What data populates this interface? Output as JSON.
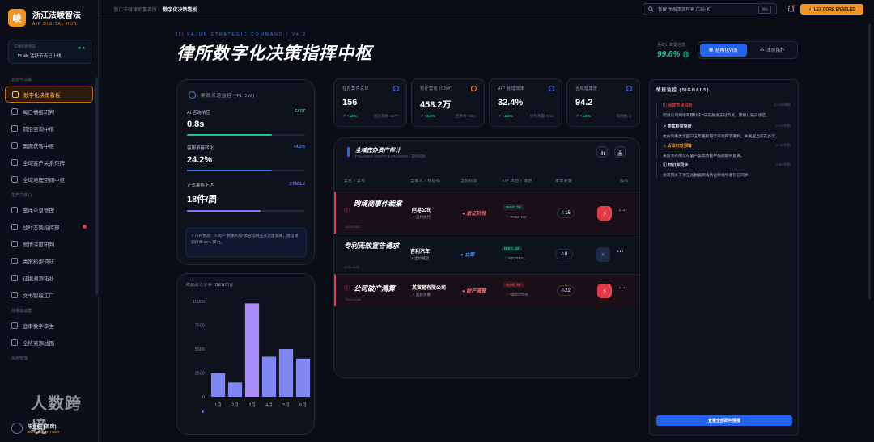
{
  "brand": {
    "badge": "崚",
    "name": "浙江法崚智法",
    "sub": "AIP DIGITAL HUB"
  },
  "sidebar": {
    "status_label": "实体同步状态",
    "status_value": "15.4K 活跃节点已上线",
    "sections": [
      {
        "title": "智能与决策",
        "items": [
          {
            "label": "数字化决策看板",
            "active": true
          },
          {
            "label": "每日情报研判"
          },
          {
            "label": "前沿咨询中枢"
          },
          {
            "label": "案源获客中枢"
          },
          {
            "label": "全域客户关系矩阵"
          },
          {
            "label": "全域地理空间中枢"
          }
        ]
      },
      {
        "title": "生产力核心",
        "items": [
          {
            "label": "案件全景管理"
          },
          {
            "label": "战时态势指挥部",
            "dot": true
          },
          {
            "label": "案情深度研判"
          },
          {
            "label": "类案检索调研"
          },
          {
            "label": "证据溯源拓扑"
          },
          {
            "label": "文书智绘工厂"
          }
        ]
      },
      {
        "title": "战争模拟器",
        "items": [
          {
            "label": "庭审数字孪生"
          },
          {
            "label": "全所资源战图"
          }
        ]
      },
      {
        "title": "风险管理",
        "items": []
      }
    ],
    "footer_name": "陈主任 (首席)",
    "footer_role": "SENIOR PARTNER"
  },
  "watermark": "人数跨境",
  "topbar": {
    "breadcrumb_root": "浙江法崚律师事务所 /",
    "breadcrumb_current": "数字化决策看板",
    "search_placeholder": "智搜 全局本体检索 (Ctrl+K)",
    "search_kbd": "⌘K",
    "lex_label": "LEX CORE ENABLED"
  },
  "header": {
    "tag": "||| FAJUN STRATEGIC COMMAND / V4.2",
    "title": "律所数字化决策指挥中枢",
    "rate_label": "系统计算置信度",
    "rate_value": "99.8% ◍",
    "toggle_structured": "结构化列表",
    "toggle_topology": "本体拓扑"
  },
  "flow": {
    "title": "案源流速监控 (FLOW)",
    "metrics": [
      {
        "label": "AI 咨询响应",
        "tag": "FAST",
        "value": "0.8s",
        "fill": 0.72,
        "color": "#20c08a"
      },
      {
        "label": "客服承接转化",
        "tag": "+4.2%",
        "value": "24.2%",
        "fill": 0.72,
        "color": "#3e7cf0"
      },
      {
        "label": "正式案件下达",
        "tag": "STABLE",
        "value": "18件/周",
        "fill": 0.62,
        "color": "#8b6cf6"
      }
    ],
    "prediction": "✧ AIP 预测：下周一“民事纠纷”类咨询将迎来流量高峰，建议增加律师 15% 算力。"
  },
  "bench": {
    "title": "实战战力分布 (BENCH)"
  },
  "chart_data": {
    "type": "bar",
    "title": "实战战力分布 (BENCH)",
    "categories": [
      "1月",
      "2月",
      "3月",
      "4月",
      "5月",
      "6月"
    ],
    "values": [
      2500,
      1500,
      9800,
      4200,
      5000,
      4000
    ],
    "highlight_index": 2,
    "ylim": [
      0,
      10000
    ],
    "yticks": [
      "0",
      "2500",
      "5000",
      "7500",
      "10000"
    ],
    "colors": {
      "bar": "#7f87f4",
      "highlight": "#a98bf7"
    }
  },
  "kpis": [
    {
      "label": "在办案件总体",
      "value": "156",
      "delta": "↗ +12%",
      "sub": "团队实绩: 62个",
      "icon_color": "#3e7cf0"
    },
    {
      "label": "预计营收 (CNY)",
      "value": "458.2万",
      "delta": "↗ +8.5%",
      "sub": "回款率: 72%",
      "icon_color": "#f09423"
    },
    {
      "label": "AIP 处理效率",
      "value": "32.4%",
      "delta": "↗ +4.2%",
      "sub": "研判速度: 1.2s",
      "icon_color": "#3e7cf0"
    },
    {
      "label": "合规健康度",
      "value": "94.2",
      "delta": "↗ +1.5%",
      "sub": "风险数: 0",
      "icon_color": "#3e7cf0"
    }
  ],
  "audit": {
    "title": "全域在办资产审计",
    "subtitle": "FOUNDRY ENTITY EXPLORER / 实时同频",
    "headers": [
      "案名 / 案号",
      "当事人 / 特征码",
      "当前阶段",
      "AIP 风险 / 情感",
      "本体关联",
      "操作"
    ],
    "rows": [
      {
        "name": "跨境商事仲裁案",
        "date": "2026-0812",
        "party": "阿易公司",
        "role": "↗ 里约执行",
        "stage": "● 质证阶段",
        "stage_color": "#ff5a6e",
        "risk": "RISK: 24",
        "risk_color": "#20c08a",
        "tone": "♡ POSITIVE",
        "assoc": "15",
        "bolt_color": "#e23b4a",
        "alert": true
      },
      {
        "name": "专利无效宣告请求",
        "date": "2026-0105",
        "party": "吉利汽车",
        "role": "↗ 里约撤回",
        "stage": "● 立案",
        "stage_color": "#4d8cf5",
        "risk": "RISK: 42",
        "risk_color": "#20c08a",
        "tone": "♡ NEUTRAL",
        "assoc": "8",
        "bolt_color": "#1f2a45",
        "alert": false
      },
      {
        "name": "公司破产清算",
        "date": "2023-4065",
        "party": "某贸易有限公司",
        "role": "↗ 股链清算",
        "stage": "● 财产清算",
        "stage_color": "#ff5a6e",
        "risk": "RISK: 68",
        "risk_color": "#e23b4a",
        "tone": "♡ NEGATIVE",
        "assoc": "22",
        "bolt_color": "#e23b4a",
        "alert": true
      }
    ]
  },
  "signals": {
    "title": "情报监控 (SIGNALS)",
    "items": [
      {
        "title": "ⓘ 回款节点风险",
        "time": "◷ 10分钟前",
        "desc": "阿易公司将增率预计于3日内触发支付节点，需确认账户状态。",
        "color": "#e23b4a"
      },
      {
        "title": "↗ 类案检索突破",
        "time": "◷ 1小时前",
        "desc": "杭州凯撒类案回日五年最新赔案率指挥等要判，关联至当前在办案。",
        "color": "#cfd6e6"
      },
      {
        "title": "⚠ 诉讼时效预警",
        "time": "◷ 3小时前",
        "desc": "某贸易有限公司破产案需债权申报期即将届满。",
        "color": "#f09423"
      },
      {
        "title": "ⓘ 知识库同步",
        "time": "◷ 5小时前",
        "desc": "浙高院关于浙江省数据跨境执行新指导意见已同步.",
        "color": "#cfd6e6"
      }
    ],
    "button": "查看全部研判情报"
  }
}
